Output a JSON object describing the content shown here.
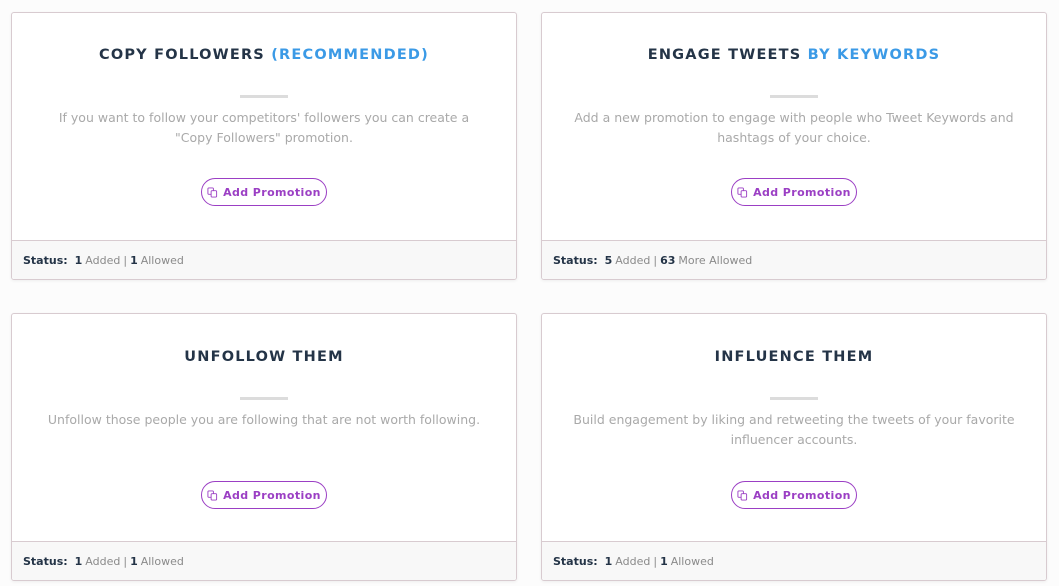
{
  "colors": {
    "title": "#243447",
    "accent": "#3b9ae6",
    "button": "#9b3fc4",
    "description": "#a9a9a9",
    "border": "#d8cbd0",
    "footer_bg": "#f8f8f8"
  },
  "cards": [
    {
      "title": "COPY FOLLOWERS",
      "title_accent": "(RECOMMENDED)",
      "description": "If you want to follow your competitors' followers you can create a \"Copy Followers\" promotion.",
      "button": {
        "label": "Add Promotion",
        "icon": "copy-icon"
      },
      "status": {
        "label": "Status:",
        "added_count": "1",
        "added_label": "Added",
        "separator": "|",
        "allowed_count": "1",
        "allowed_label": "Allowed"
      }
    },
    {
      "title": "ENGAGE TWEETS",
      "title_accent": "BY KEYWORDS",
      "description": "Add a new promotion to engage with people who Tweet Keywords and hashtags of your choice.",
      "button": {
        "label": "Add Promotion",
        "icon": "copy-icon"
      },
      "status": {
        "label": "Status:",
        "added_count": "5",
        "added_label": "Added",
        "separator": "|",
        "allowed_count": "63",
        "allowed_label": "More Allowed"
      }
    },
    {
      "title": "UNFOLLOW THEM",
      "title_accent": "",
      "description": "Unfollow those people you are following that are not worth following.",
      "button": {
        "label": "Add Promotion",
        "icon": "copy-icon"
      },
      "status": {
        "label": "Status:",
        "added_count": "1",
        "added_label": "Added",
        "separator": "|",
        "allowed_count": "1",
        "allowed_label": "Allowed"
      }
    },
    {
      "title": "INFLUENCE THEM",
      "title_accent": "",
      "description": "Build engagement by liking and retweeting the tweets of your favorite influencer accounts.",
      "button": {
        "label": "Add Promotion",
        "icon": "copy-icon"
      },
      "status": {
        "label": "Status:",
        "added_count": "1",
        "added_label": "Added",
        "separator": "|",
        "allowed_count": "1",
        "allowed_label": "Allowed"
      }
    }
  ]
}
